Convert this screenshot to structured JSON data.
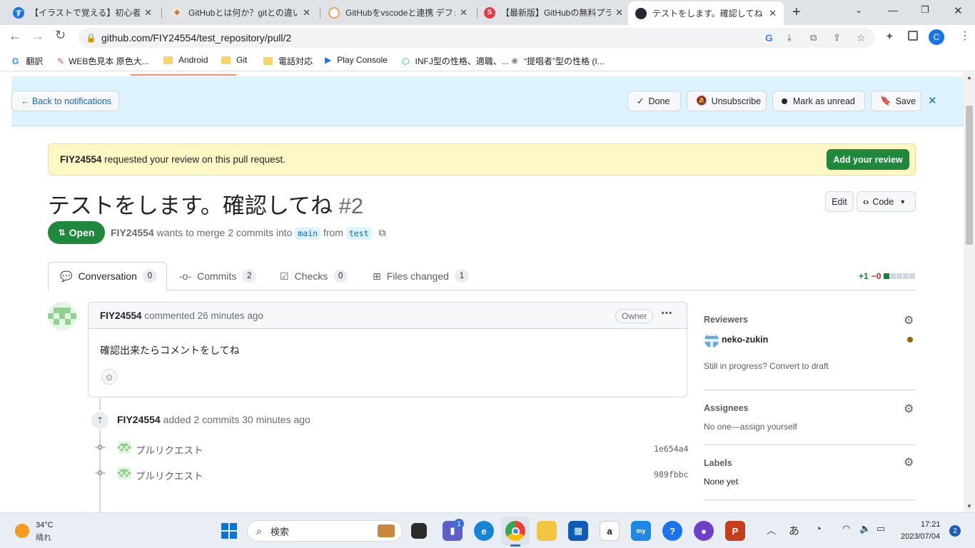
{
  "browser": {
    "tabs": [
      {
        "title": "【イラストで覚える】初心者のため",
        "color": "#1a73e8",
        "glyph": "す"
      },
      {
        "title": "GitHubとは何か？gitとの違いや",
        "color": "#d08770",
        "glyph": "◆"
      },
      {
        "title": "GitHubをvscodeと連携 デフォル",
        "color": "#f4a261",
        "glyph": "◌"
      },
      {
        "title": "【最新版】GitHubの無料プランで",
        "color": "#e63946",
        "glyph": "S"
      },
      {
        "title": "テストをします。確認してね by FI",
        "color": "#24292f",
        "glyph": "●"
      }
    ],
    "url": "github.com/FIY24554/test_repository/pull/2",
    "profile_initial": "C",
    "bookmarks": [
      "翻訳",
      "WEB色見本 原色大...",
      "Android",
      "Git",
      "電話対応",
      "Play Console",
      "INFJ型の性格、適職、...",
      "“提唱者”型の性格 (I..."
    ]
  },
  "notification_bar": {
    "back": "← Back to notifications",
    "done": "Done",
    "unsubscribe": "Unsubscribe",
    "mark_unread": "Mark as unread",
    "save": "Save"
  },
  "review_banner": {
    "user": "FIY24554",
    "text": " requested your review on this pull request.",
    "button": "Add your review"
  },
  "pr": {
    "title": "テストをします。確認してね",
    "number": "#2",
    "edit": "Edit",
    "code": "Code",
    "state": "Open",
    "author": "FIY24554",
    "merge_text": " wants to merge 2 commits into ",
    "base": "main",
    "from": " from ",
    "head": "test"
  },
  "tabs": [
    {
      "label": "Conversation",
      "count": "0"
    },
    {
      "label": "Commits",
      "count": "2"
    },
    {
      "label": "Checks",
      "count": "0"
    },
    {
      "label": "Files changed",
      "count": "1"
    }
  ],
  "diffstat": {
    "added": "+1",
    "removed": "−0"
  },
  "comment": {
    "author": "FIY24554",
    "meta": " commented 26 minutes ago",
    "role": "Owner",
    "body": "確認出来たらコメントをしてね"
  },
  "commits_event": {
    "author": "FIY24554",
    "text": " added 2 commits 30 minutes ago",
    "commits": [
      {
        "message": "プルリクエスト",
        "sha": "1e654a4"
      },
      {
        "message": "プルリクエスト",
        "sha": "989fbbc"
      }
    ]
  },
  "sidebar": {
    "reviewers_title": "Reviewers",
    "reviewer": "neko-zukin",
    "reviewer_status_color": "#9a6700",
    "progress_text": "Still in progress? ",
    "convert": "Convert to draft",
    "assignees_title": "Assignees",
    "no_one": "No one—",
    "assign": "assign yourself",
    "labels_title": "Labels",
    "labels_value": "None yet"
  },
  "taskbar": {
    "temp": "34°C",
    "weather": "晴れ",
    "search": "検索",
    "time": "17:21",
    "date": "2023/07/04",
    "ime": "あ",
    "notif_count": "2",
    "teams_badge": "1"
  }
}
